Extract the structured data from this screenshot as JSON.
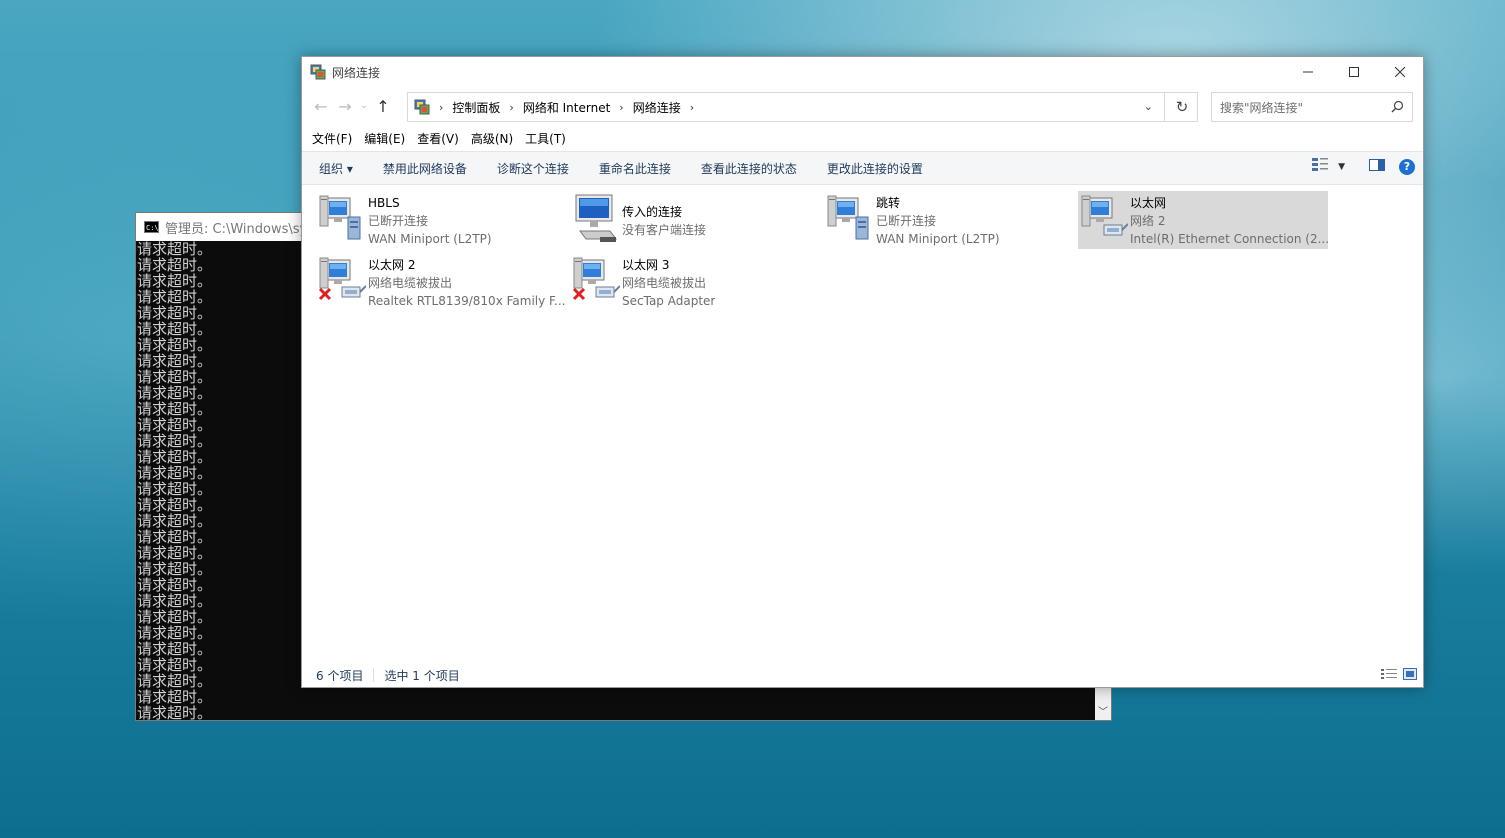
{
  "cmd": {
    "title": "管理员: C:\\Windows\\syst",
    "icon": "cmd-icon",
    "lines": [
      "请求超时。",
      "请求超时。",
      "请求超时。",
      "请求超时。",
      "请求超时。",
      "请求超时。",
      "请求超时。",
      "请求超时。",
      "请求超时。",
      "请求超时。",
      "请求超时。",
      "请求超时。",
      "请求超时。",
      "请求超时。",
      "请求超时。",
      "请求超时。",
      "请求超时。",
      "请求超时。",
      "请求超时。",
      "请求超时。",
      "请求超时。",
      "请求超时。",
      "请求超时。",
      "请求超时。",
      "请求超时。",
      "请求超时。",
      "请求超时。",
      "请求超时。",
      "请求超时。",
      "请求超时。"
    ]
  },
  "window": {
    "title": "网络连接",
    "breadcrumb": [
      "控制面板",
      "网络和 Internet",
      "网络连接"
    ],
    "search_placeholder": "搜索\"网络连接\"",
    "menu": [
      "文件(F)",
      "编辑(E)",
      "查看(V)",
      "高级(N)",
      "工具(T)"
    ],
    "commands": [
      "组织 ▾",
      "禁用此网络设备",
      "诊断这个连接",
      "重命名此连接",
      "查看此连接的状态",
      "更改此连接的设置"
    ],
    "items": [
      {
        "name": "HBLS",
        "status": "已断开连接",
        "device": "WAN Miniport (L2TP)",
        "icon": "vpn-icon"
      },
      {
        "name": "传入的连接",
        "status": "没有客户端连接",
        "device": "",
        "icon": "incoming-connection-icon"
      },
      {
        "name": "跳转",
        "status": "已断开连接",
        "device": "WAN Miniport (L2TP)",
        "icon": "vpn-icon"
      },
      {
        "name": "以太网",
        "status": "网络 2",
        "device": "Intel(R) Ethernet Connection (2...",
        "icon": "ethernet-icon",
        "selected": true
      },
      {
        "name": "以太网 2",
        "status": "网络电缆被拔出",
        "device": "Realtek RTL8139/810x Family F...",
        "icon": "ethernet-unplugged-icon"
      },
      {
        "name": "以太网 3",
        "status": "网络电缆被拔出",
        "device": "SecTap Adapter",
        "icon": "ethernet-unplugged-icon"
      }
    ],
    "status": {
      "count": "6 个项目",
      "selected": "选中 1 个项目"
    }
  },
  "colors": {
    "accent": "#1f6fd0",
    "selected_bg": "#d9d9d9",
    "command_text": "#1e395b"
  }
}
